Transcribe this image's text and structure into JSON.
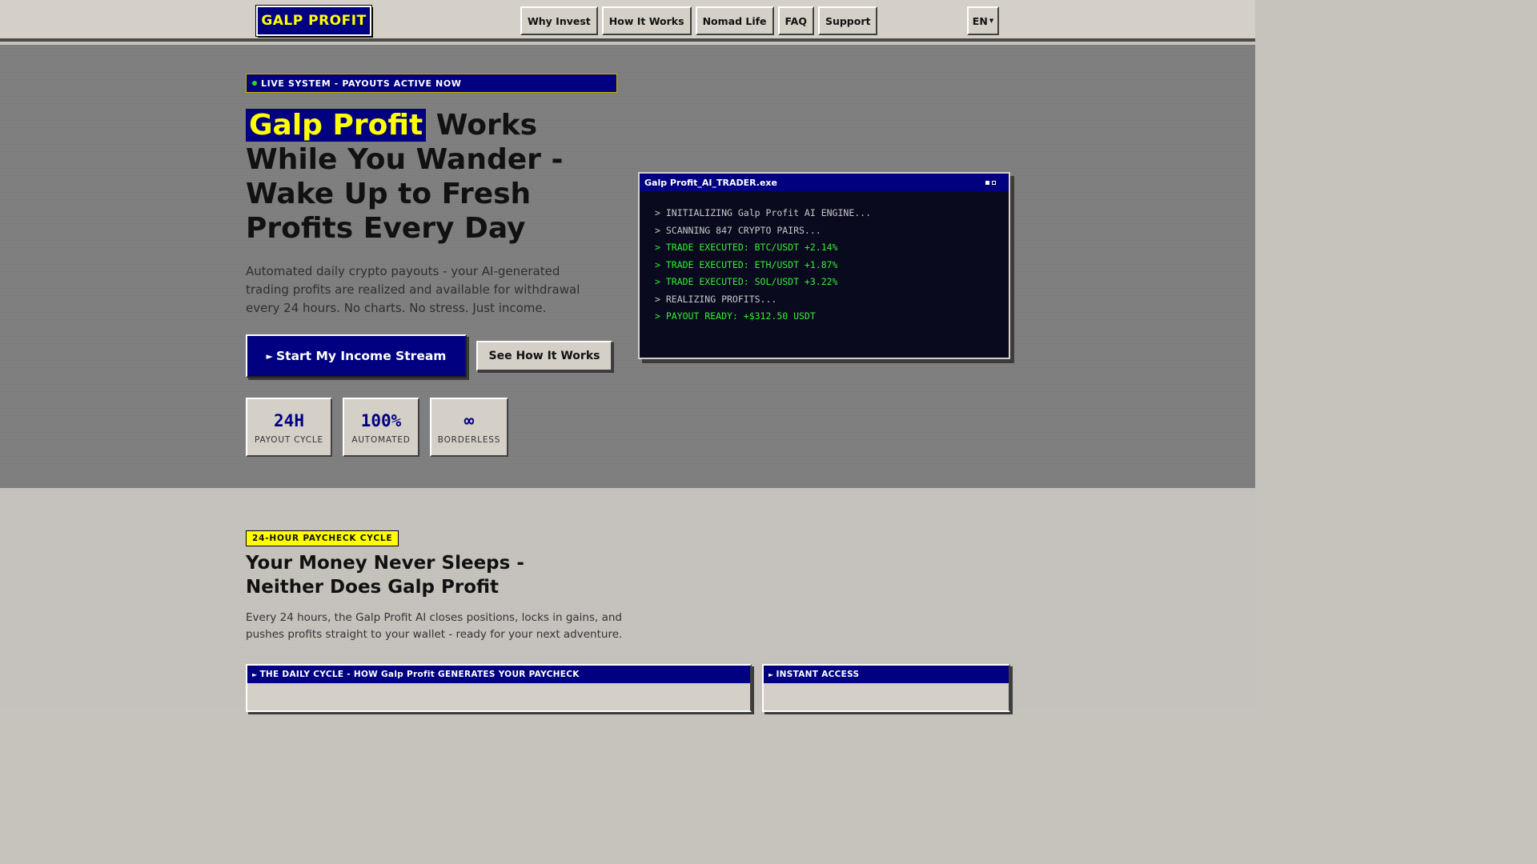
{
  "header": {
    "logo": "GALP PROFIT",
    "nav": [
      "Why Invest",
      "How It Works",
      "Nomad Life",
      "FAQ",
      "Support"
    ],
    "language": "EN"
  },
  "hero": {
    "live_badge": "LIVE SYSTEM - PAYOUTS ACTIVE NOW",
    "headline_highlight": "Galp Profit",
    "headline_rest": " Works While You Wander - Wake Up to Fresh Profits Every Day",
    "subtext": "Automated daily crypto payouts - your AI-generated trading profits are realized and available for withdrawal every 24 hours. No charts. No stress. Just income.",
    "primary_cta": "Start My Income Stream",
    "secondary_cta": "See How It Works",
    "stats": [
      {
        "value": "24H",
        "label": "PAYOUT CYCLE"
      },
      {
        "value": "100%",
        "label": "AUTOMATED"
      },
      {
        "value": "∞",
        "label": "BORDERLESS"
      }
    ],
    "terminal": {
      "title": "Galp Profit_AI_TRADER.exe",
      "lines": [
        {
          "text": "> INITIALIZING Galp Profit AI ENGINE...",
          "kind": "info"
        },
        {
          "text": "> SCANNING 847 CRYPTO PAIRS...",
          "kind": "info"
        },
        {
          "text": "> TRADE EXECUTED: BTC/USDT +2.14%",
          "kind": "ok"
        },
        {
          "text": "> TRADE EXECUTED: ETH/USDT +1.87%",
          "kind": "ok"
        },
        {
          "text": "> TRADE EXECUTED: SOL/USDT +3.22%",
          "kind": "ok"
        },
        {
          "text": "> REALIZING PROFITS...",
          "kind": "info"
        },
        {
          "text": "> PAYOUT READY: +$312.50 USDT",
          "kind": "ok"
        }
      ]
    }
  },
  "section2": {
    "tag": "24-HOUR PAYCHECK CYCLE",
    "title": "Your Money Never Sleeps - Neither Does Galp Profit",
    "text": "Every 24 hours, the Galp Profit AI closes positions, locks in gains, and pushes profits straight to your wallet - ready for your next adventure.",
    "panels": [
      {
        "title": "THE DAILY CYCLE - HOW Galp Profit GENERATES YOUR PAYCHECK"
      },
      {
        "title": "INSTANT ACCESS"
      }
    ]
  },
  "colors": {
    "navy": "#000080",
    "yellow": "#ffff00",
    "terminal_green": "#33ee33",
    "panel_gray": "#d4d0c8"
  }
}
